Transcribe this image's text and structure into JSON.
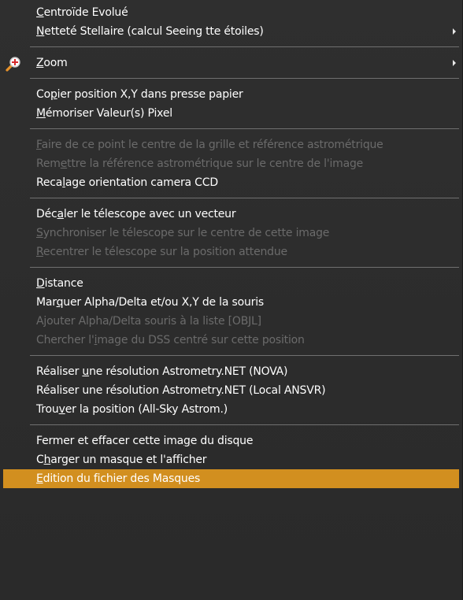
{
  "menu": {
    "groups": [
      [
        {
          "pre": "",
          "mn": "C",
          "post": "entroïde Evolué",
          "disabled": false
        },
        {
          "pre": "",
          "mn": "N",
          "post": "etteté Stellaire (calcul Seeing tte étoiles)",
          "disabled": false,
          "submenu": true
        }
      ],
      [
        {
          "pre": "",
          "mn": "Z",
          "post": "oom",
          "disabled": false,
          "submenu": true,
          "icon": "zoom-magnifier-icon"
        }
      ],
      [
        {
          "pre": "Co",
          "mn": "p",
          "post": "ier position X,Y dans presse papier",
          "disabled": false
        },
        {
          "pre": "",
          "mn": "M",
          "post": "émoriser Valeur(s) Pixel",
          "disabled": false
        }
      ],
      [
        {
          "pre": "",
          "mn": "F",
          "post": "aire de ce point le centre de la grille et référence astrométrique",
          "disabled": true
        },
        {
          "pre": "Rem",
          "mn": "e",
          "post": "ttre la référence astrométrique sur le centre de l'image",
          "disabled": true
        },
        {
          "pre": "Reca",
          "mn": "l",
          "post": "age orientation camera CCD",
          "disabled": false
        }
      ],
      [
        {
          "pre": "Déc",
          "mn": "a",
          "post": "ler le télescope avec un vecteur",
          "disabled": false
        },
        {
          "pre": "",
          "mn": "S",
          "post": "ynchroniser le télescope sur le centre de cette image",
          "disabled": true
        },
        {
          "pre": "",
          "mn": "R",
          "post": "ecentrer le télescope sur la position attendue",
          "disabled": true
        }
      ],
      [
        {
          "pre": "",
          "mn": "D",
          "post": "istance",
          "disabled": false
        },
        {
          "pre": "Mar",
          "mn": "q",
          "post": "uer Alpha/Delta et/ou  X,Y de la souris",
          "disabled": false
        },
        {
          "pre": "Ajouter Alpha/Delta souris à la liste [OBJL]",
          "mn": "",
          "post": "",
          "disabled": true
        },
        {
          "pre": "Chercher l'",
          "mn": "i",
          "post": "mage du DSS centré sur cette position",
          "disabled": true
        }
      ],
      [
        {
          "pre": "Réaliser ",
          "mn": "u",
          "post": "ne résolution Astrometry.NET (NOVA)",
          "disabled": false
        },
        {
          "pre": "Réaliser une résolution Astrometr",
          "mn": "y",
          "post": ".NET (Local ANSVR)",
          "disabled": false
        },
        {
          "pre": "Trou",
          "mn": "v",
          "post": "er la position (All-Sky Astrom.)",
          "disabled": false
        }
      ],
      [
        {
          "pre": "Fermer et effacer cette ima",
          "mn": "g",
          "post": "e du disque",
          "disabled": false
        },
        {
          "pre": "C",
          "mn": "h",
          "post": "arger un masque et l'afficher",
          "disabled": false
        },
        {
          "pre": "",
          "mn": "E",
          "post": "dition du fichier des Masques",
          "disabled": false,
          "selected": true
        }
      ]
    ],
    "colors": {
      "background": "#2b2b2b",
      "text": "#ffffff",
      "disabled_text": "#6b6b6b",
      "separator": "#707070",
      "selection": "#d28f1f"
    }
  }
}
